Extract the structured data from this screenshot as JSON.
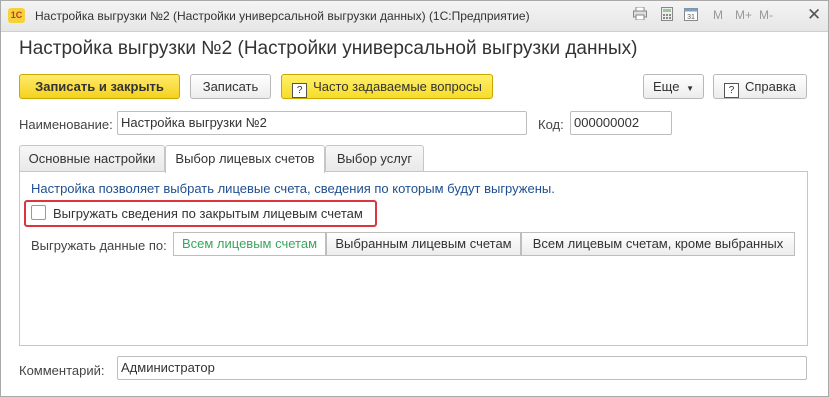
{
  "window": {
    "title": "Настройка выгрузки №2 (Настройки универсальной выгрузки данных)  (1С:Предприятие)",
    "logo_text": "1C",
    "toolbar_m": [
      "M",
      "M+",
      "M-"
    ],
    "icons": [
      "print-icon",
      "calculator-icon",
      "calendar-icon",
      "close-icon"
    ]
  },
  "form": {
    "title": "Настройка выгрузки №2 (Настройки универсальной выгрузки данных)"
  },
  "toolbar": {
    "save_close": "Записать и закрыть",
    "save": "Записать",
    "faq": "Часто задаваемые вопросы",
    "faq_icon": "?",
    "more": "Еще",
    "help": "Справка",
    "help_icon": "?"
  },
  "fields": {
    "name_label": "Наименование:",
    "name_value": "Настройка выгрузки №2",
    "code_label": "Код:",
    "code_value": "000000002",
    "comment_label": "Комментарий:",
    "comment_value": "Администратор"
  },
  "tabs": [
    {
      "label": "Основные настройки",
      "active": false
    },
    {
      "label": "Выбор лицевых счетов",
      "active": true
    },
    {
      "label": "Выбор услуг",
      "active": false
    }
  ],
  "panel": {
    "info": "Настройка позволяет выбрать лицевые счета, сведения по которым будут выгружены.",
    "checkbox_label": "Выгружать сведения по закрытым лицевым счетам",
    "checkbox_checked": false,
    "export_by_label": "Выгружать данные по:",
    "options": [
      {
        "label": "Всем лицевым счетам",
        "selected": true
      },
      {
        "label": "Выбранным лицевым счетам",
        "selected": false
      },
      {
        "label": "Всем лицевым счетам, кроме выбранных",
        "selected": false
      }
    ]
  },
  "colors": {
    "primary": "#f5d21f",
    "info_text": "#1f4f8f",
    "highlight": "#d9363e",
    "selected_option": "#3aa55c"
  }
}
